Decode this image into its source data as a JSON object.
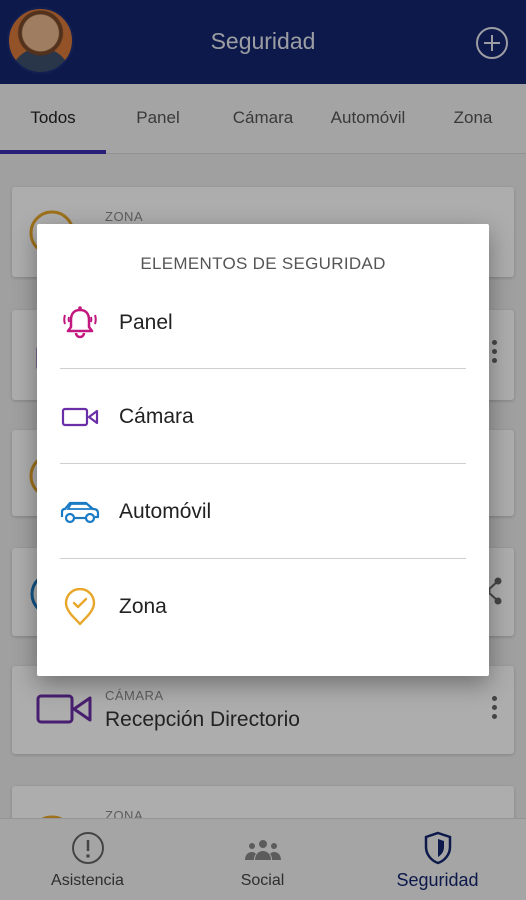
{
  "header": {
    "title": "Seguridad"
  },
  "tabs": [
    {
      "label": "Todos",
      "active": true
    },
    {
      "label": "Panel"
    },
    {
      "label": "Cámara"
    },
    {
      "label": "Automóvil"
    },
    {
      "label": "Zona"
    }
  ],
  "list": [
    {
      "kind": "ZONA",
      "name": "",
      "icon": "zone-icon"
    },
    {
      "kind": "",
      "name": "",
      "icon": "camera-icon"
    },
    {
      "kind": "",
      "name": "",
      "icon": "zone-icon"
    },
    {
      "kind": "",
      "name": "",
      "icon": "car-icon"
    },
    {
      "kind": "CÁMARA",
      "name": "Recepción Directorio",
      "icon": "camera-icon"
    },
    {
      "kind": "ZONA",
      "name": "",
      "icon": "zone-icon"
    }
  ],
  "dialog": {
    "title": "ELEMENTOS DE SEGURIDAD",
    "options": [
      {
        "label": "Panel",
        "icon": "bell-icon",
        "color": "#c2177f"
      },
      {
        "label": "Cámara",
        "icon": "camera-icon",
        "color": "#6a2fa6"
      },
      {
        "label": "Automóvil",
        "icon": "car-icon",
        "color": "#1a7bc4"
      },
      {
        "label": "Zona",
        "icon": "zone-check-icon",
        "color": "#e9a72a"
      }
    ]
  },
  "bottom_nav": [
    {
      "label": "Asistencia",
      "icon": "alert-circle-icon"
    },
    {
      "label": "Social",
      "icon": "people-icon"
    },
    {
      "label": "Seguridad",
      "icon": "shield-icon",
      "active": true
    }
  ],
  "colors": {
    "primary": "#13256d",
    "accent": "#3a2fb0"
  }
}
